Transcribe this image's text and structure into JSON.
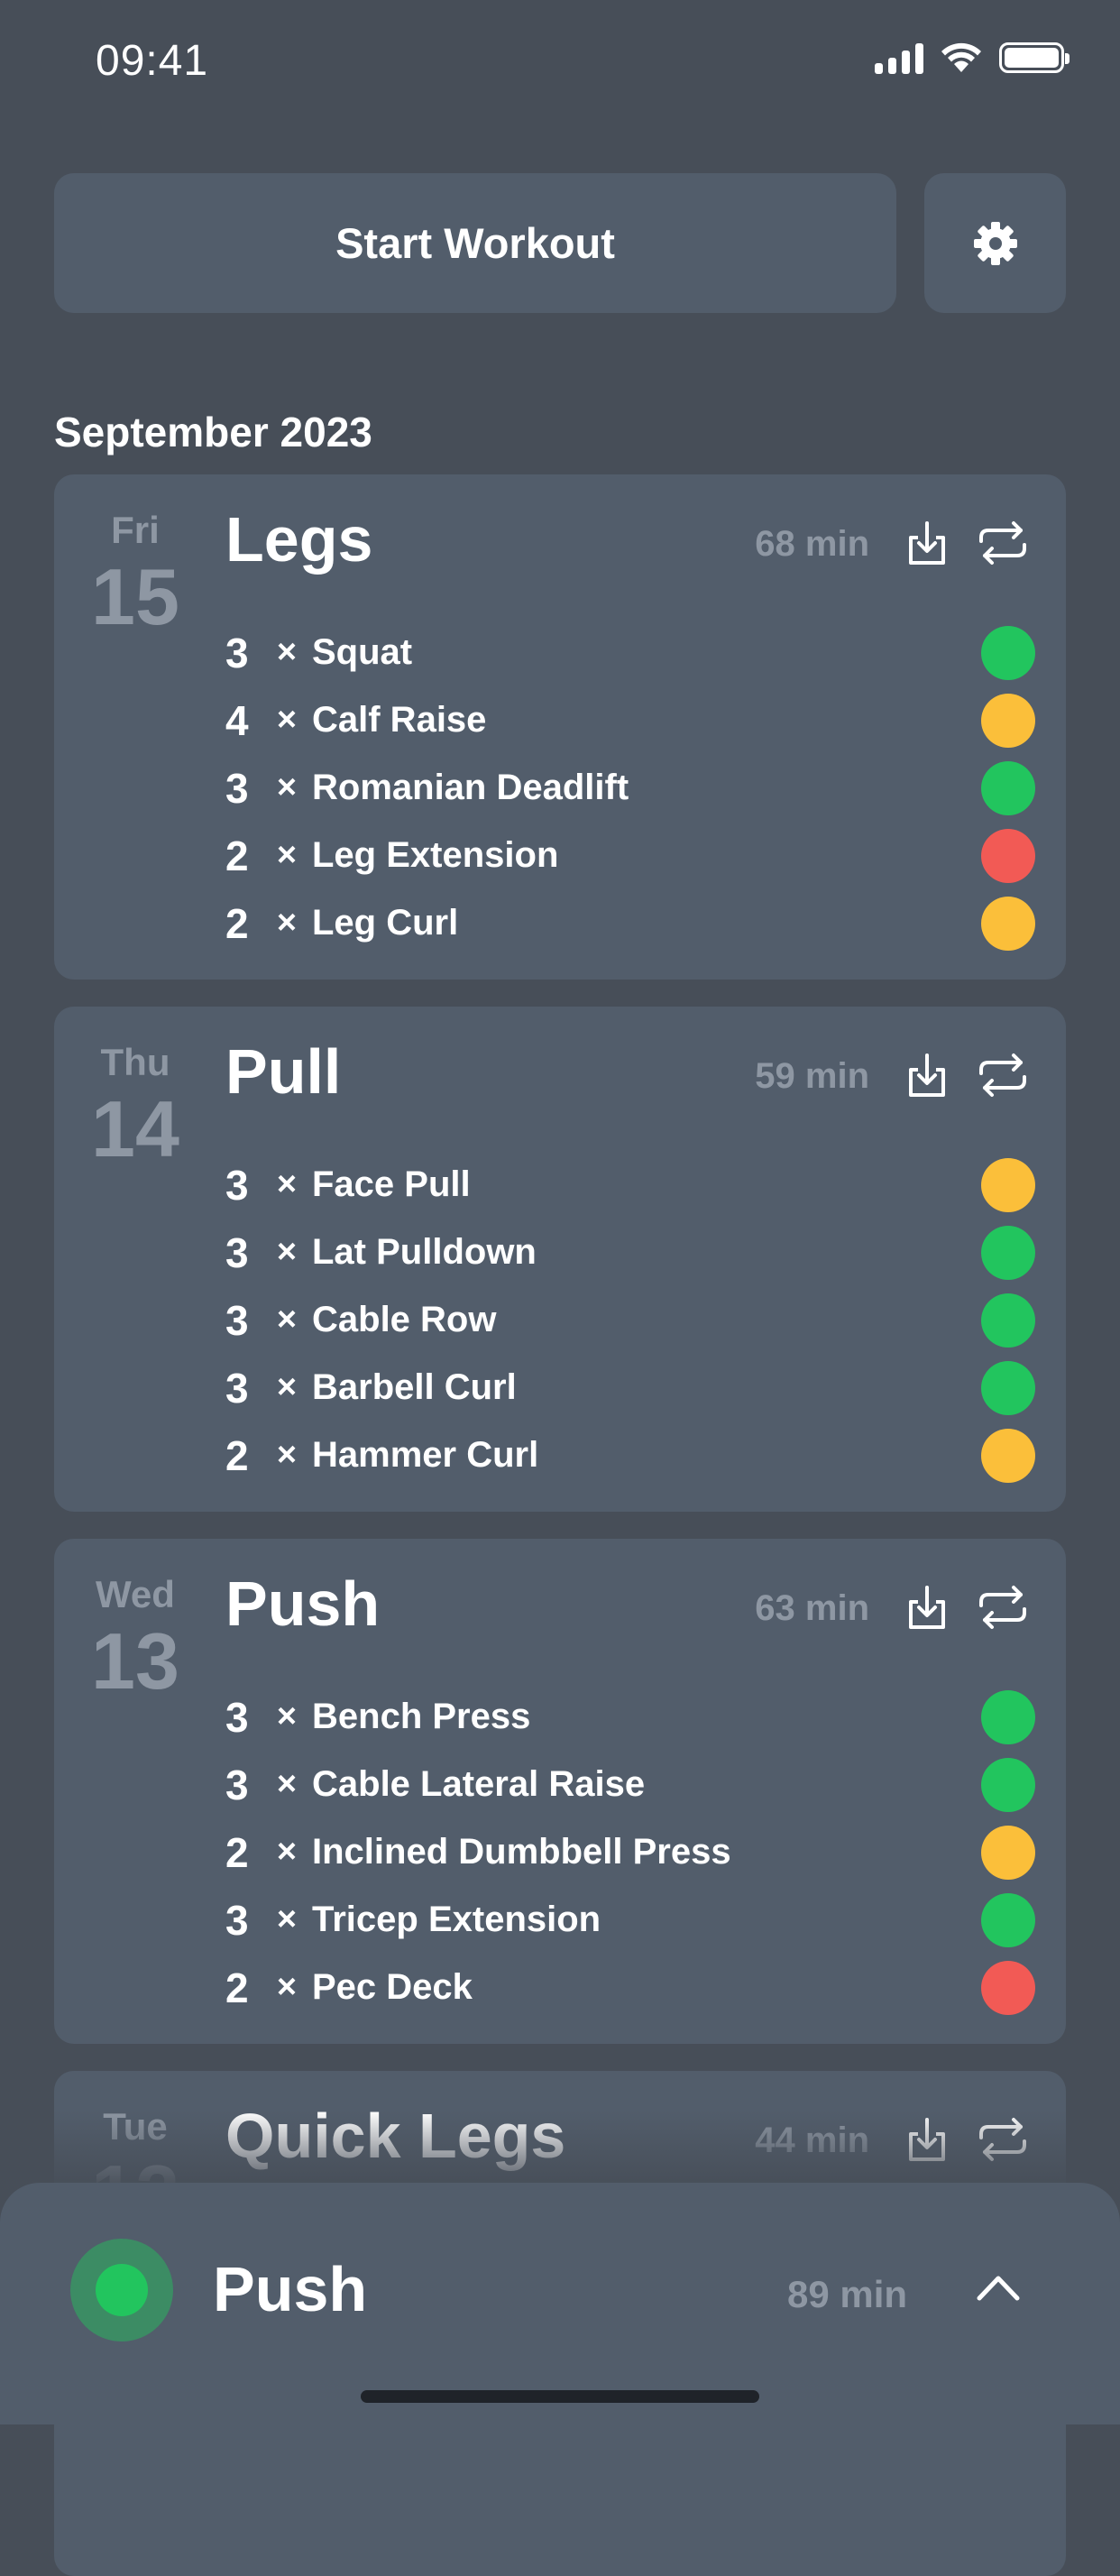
{
  "status_bar": {
    "time": "09:41"
  },
  "header": {
    "start_label": "Start Workout"
  },
  "month_label": "September 2023",
  "colors": {
    "green": "#22c55e",
    "yellow": "#fbbf3a",
    "red": "#f25a55"
  },
  "workouts": [
    {
      "dow": "Fri",
      "day": "15",
      "title": "Legs",
      "duration": "68 min",
      "exercises": [
        {
          "sets": "3",
          "x": "×",
          "name": "Squat",
          "status": "green"
        },
        {
          "sets": "4",
          "x": "×",
          "name": "Calf Raise",
          "status": "yellow"
        },
        {
          "sets": "3",
          "x": "×",
          "name": "Romanian Deadlift",
          "status": "green"
        },
        {
          "sets": "2",
          "x": "×",
          "name": "Leg Extension",
          "status": "red"
        },
        {
          "sets": "2",
          "x": "×",
          "name": "Leg Curl",
          "status": "yellow"
        }
      ]
    },
    {
      "dow": "Thu",
      "day": "14",
      "title": "Pull",
      "duration": "59 min",
      "exercises": [
        {
          "sets": "3",
          "x": "×",
          "name": "Face Pull",
          "status": "yellow"
        },
        {
          "sets": "3",
          "x": "×",
          "name": "Lat Pulldown",
          "status": "green"
        },
        {
          "sets": "3",
          "x": "×",
          "name": "Cable Row",
          "status": "green"
        },
        {
          "sets": "3",
          "x": "×",
          "name": "Barbell Curl",
          "status": "green"
        },
        {
          "sets": "2",
          "x": "×",
          "name": "Hammer Curl",
          "status": "yellow"
        }
      ]
    },
    {
      "dow": "Wed",
      "day": "13",
      "title": "Push",
      "duration": "63 min",
      "exercises": [
        {
          "sets": "3",
          "x": "×",
          "name": "Bench Press",
          "status": "green"
        },
        {
          "sets": "3",
          "x": "×",
          "name": "Cable Lateral Raise",
          "status": "green"
        },
        {
          "sets": "2",
          "x": "×",
          "name": "Inclined Dumbbell Press",
          "status": "yellow"
        },
        {
          "sets": "3",
          "x": "×",
          "name": "Tricep Extension",
          "status": "green"
        },
        {
          "sets": "2",
          "x": "×",
          "name": "Pec Deck",
          "status": "red"
        }
      ]
    },
    {
      "dow": "Tue",
      "day": "12",
      "title": "Quick Legs",
      "duration": "44 min",
      "exercises": []
    }
  ],
  "active_workout": {
    "title": "Push",
    "duration": "89 min",
    "status": "green"
  }
}
